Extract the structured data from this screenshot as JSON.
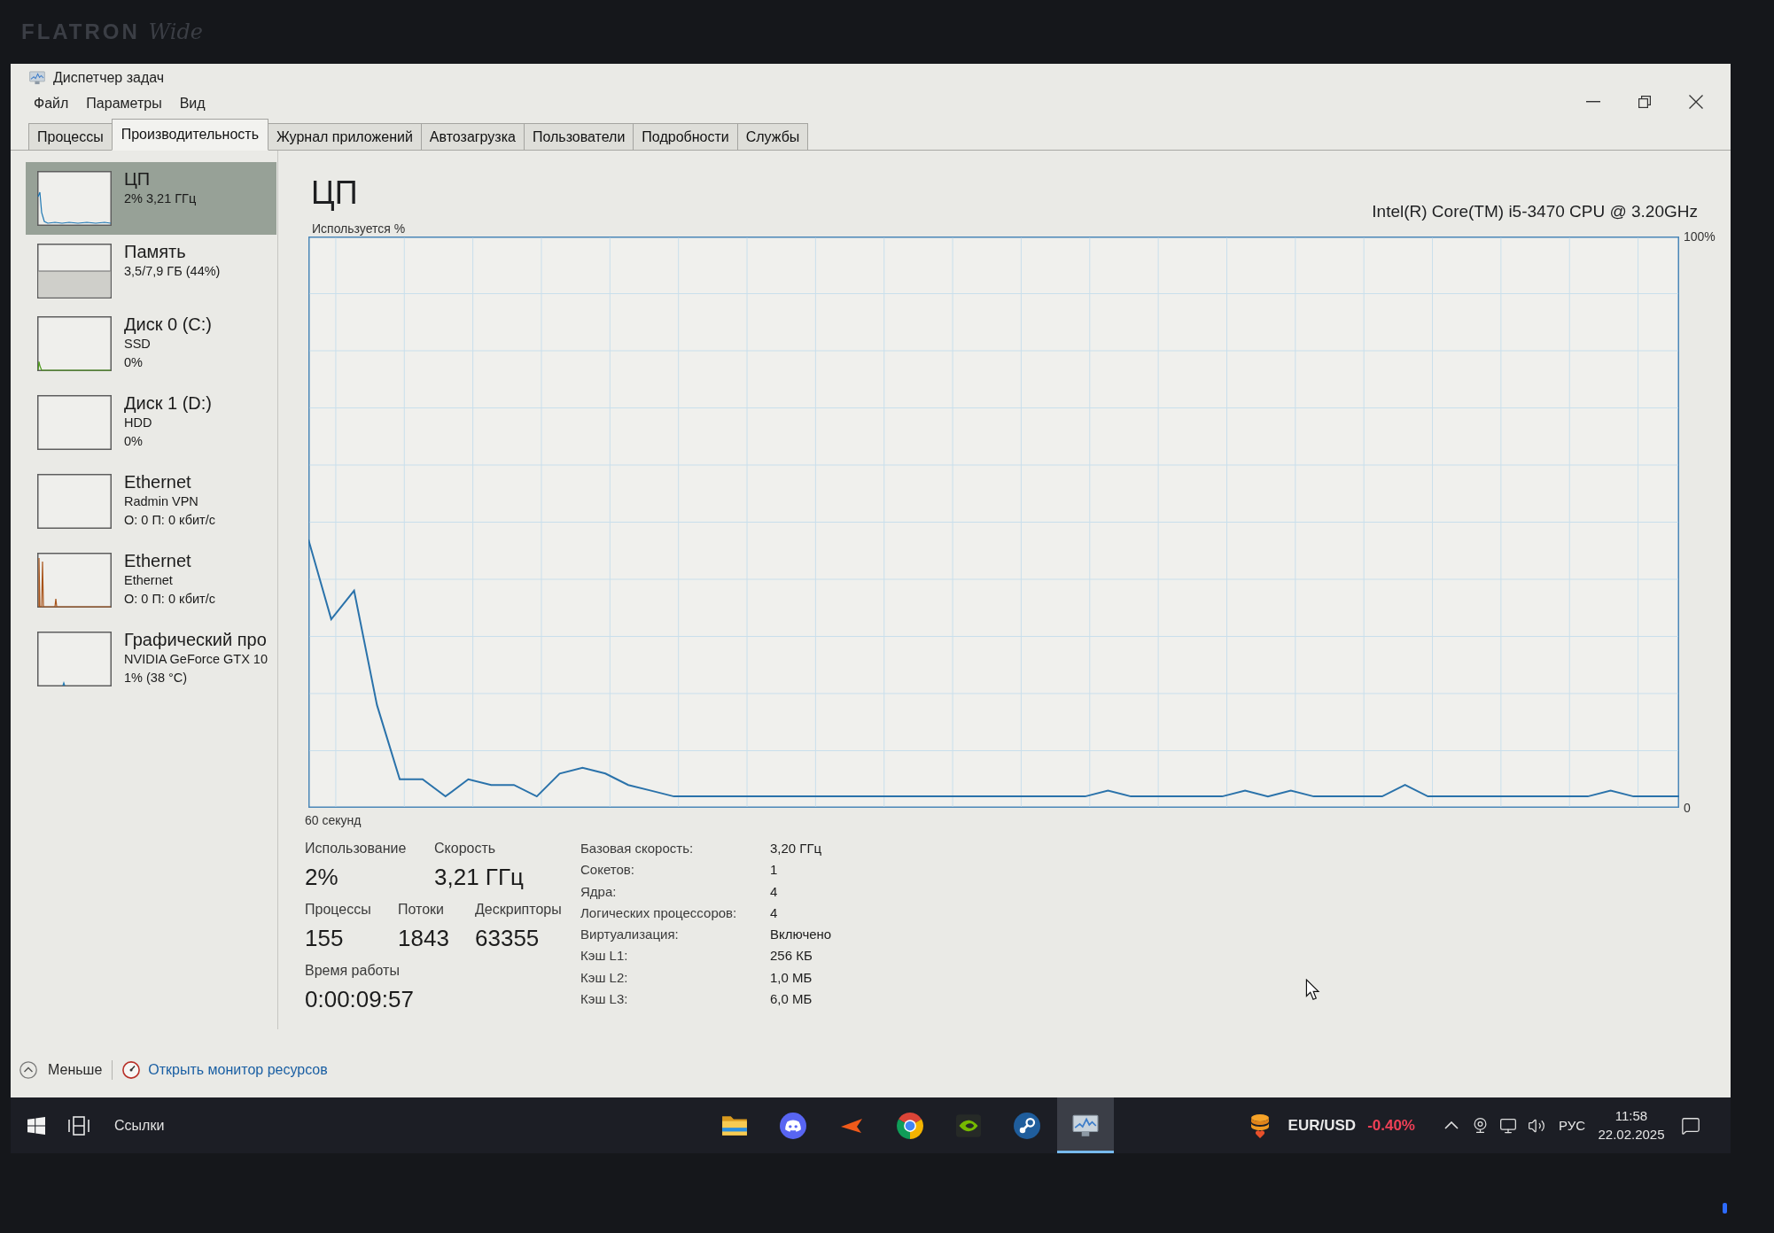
{
  "monitor": {
    "brand": "FLATRON *Wide*"
  },
  "window": {
    "title": "Диспетчер задач"
  },
  "menu": [
    "Файл",
    "Параметры",
    "Вид"
  ],
  "tabs": [
    {
      "label": "Процессы",
      "selected": false
    },
    {
      "label": "Производительность",
      "selected": true
    },
    {
      "label": "Журнал приложений",
      "selected": false
    },
    {
      "label": "Автозагрузка",
      "selected": false
    },
    {
      "label": "Пользователи",
      "selected": false
    },
    {
      "label": "Подробности",
      "selected": false
    },
    {
      "label": "Службы",
      "selected": false
    }
  ],
  "sidebar": {
    "items": [
      {
        "kind": "cpu",
        "title": "ЦП",
        "lines": [
          "2% 3,21 ГГц"
        ],
        "selected": true
      },
      {
        "kind": "memory",
        "title": "Память",
        "lines": [
          "3,5/7,9 ГБ (44%)"
        ],
        "selected": false
      },
      {
        "kind": "disk",
        "title": "Диск 0 (C:)",
        "lines": [
          "SSD",
          "0%"
        ],
        "selected": false
      },
      {
        "kind": "disk",
        "title": "Диск 1 (D:)",
        "lines": [
          "HDD",
          "0%"
        ],
        "selected": false
      },
      {
        "kind": "network",
        "title": "Ethernet",
        "lines": [
          "Radmin VPN",
          "О: 0 П: 0 кбит/с"
        ],
        "selected": false
      },
      {
        "kind": "network",
        "title": "Ethernet",
        "lines": [
          "Ethernet",
          "О: 0 П: 0 кбит/с"
        ],
        "selected": false
      },
      {
        "kind": "gpu",
        "title": "Графический про",
        "lines": [
          "NVIDIA GeForce GTX 10",
          "1% (38 °C)"
        ],
        "selected": false
      }
    ]
  },
  "detail": {
    "title": "ЦП",
    "device": "Intel(R) Core(TM) i5-3470 CPU @ 3.20GHz",
    "chart_data": {
      "type": "line",
      "ylabel": "Используется %",
      "xlabel": "60 секунд",
      "ylim": [
        0,
        100
      ],
      "yticks": [
        {
          "value": 100,
          "label": "100%"
        },
        {
          "value": 0,
          "label": "0"
        }
      ],
      "grid": true,
      "categories": [
        null,
        null,
        null,
        null,
        null,
        null,
        null,
        null,
        null,
        null,
        null,
        null,
        null,
        null,
        null,
        null,
        null,
        null,
        null,
        null,
        null,
        null,
        null,
        null,
        null,
        null,
        null,
        null,
        null,
        null,
        null,
        null,
        null,
        null,
        null,
        null,
        null,
        null,
        null,
        null,
        null,
        null,
        null,
        null,
        null,
        null,
        null,
        null,
        null,
        null,
        null,
        null,
        null,
        null,
        null,
        null,
        null,
        null,
        null,
        null,
        null
      ],
      "values": [
        47,
        33,
        38,
        18,
        5,
        5,
        2,
        5,
        4,
        4,
        2,
        6,
        7,
        6,
        4,
        3,
        2,
        2,
        2,
        2,
        2,
        2,
        2,
        2,
        2,
        2,
        2,
        2,
        2,
        2,
        2,
        2,
        2,
        2,
        2,
        3,
        2,
        2,
        2,
        2,
        2,
        3,
        2,
        3,
        2,
        2,
        2,
        2,
        4,
        2,
        2,
        2,
        2,
        2,
        2,
        2,
        2,
        3,
        2,
        2,
        2
      ]
    },
    "stat_rows": [
      {
        "items": [
          {
            "label": "Использование",
            "value": "2%"
          },
          {
            "label": "Скорость",
            "value": "3,21 ГГц"
          }
        ]
      },
      {
        "items": [
          {
            "label": "Процессы",
            "value": "155"
          },
          {
            "label": "Потоки",
            "value": "1843"
          },
          {
            "label": "Дескрипторы",
            "value": "63355"
          }
        ]
      },
      {
        "items": [
          {
            "label": "Время работы",
            "value": "0:00:09:57"
          }
        ]
      }
    ],
    "specs": [
      {
        "label": "Базовая скорость:",
        "value": "3,20 ГГц"
      },
      {
        "label": "Сокетов:",
        "value": "1"
      },
      {
        "label": "Ядра:",
        "value": "4"
      },
      {
        "label": "Логических процессоров:",
        "value": "4"
      },
      {
        "label": "Виртуализация:",
        "value": "Включено"
      },
      {
        "label": "Кэш L1:",
        "value": "256 КБ"
      },
      {
        "label": "Кэш L2:",
        "value": "1,0 МБ"
      },
      {
        "label": "Кэш L3:",
        "value": "6,0 МБ"
      }
    ]
  },
  "footer": {
    "toggle": "Меньше",
    "link": "Открыть монитор ресурсов"
  },
  "taskbar": {
    "toolbar": "Ссылки",
    "apps": [
      {
        "selected": false
      },
      {
        "selected": false
      },
      {
        "selected": false
      },
      {
        "selected": false
      },
      {
        "selected": false
      },
      {
        "selected": false
      },
      {
        "selected": true
      }
    ],
    "ticker": {
      "pair": "EUR/USD",
      "change": "-0.40%"
    },
    "language": "РУС",
    "time": "11:58",
    "date": "22.02.2025"
  }
}
